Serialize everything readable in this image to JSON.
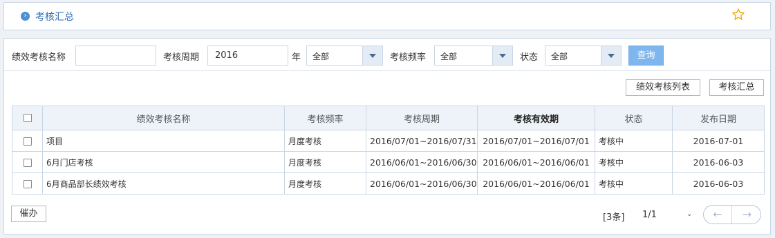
{
  "header": {
    "title": "考核汇总",
    "arrow_icon": "›"
  },
  "filter": {
    "name_label": "绩效考核名称",
    "name_value": "",
    "period_label": "考核周期",
    "period_value": "2016",
    "year_suffix": "年",
    "year_select": "全部",
    "frequency_label": "考核频率",
    "frequency_select": "全部",
    "status_label": "状态",
    "status_select": "全部",
    "query_label": "查询"
  },
  "toolbar": {
    "list_label": "绩效考核列表",
    "summary_label": "考核汇总"
  },
  "table": {
    "columns": [
      "绩效考核名称",
      "考核频率",
      "考核周期",
      "考核有效期",
      "状态",
      "发布日期"
    ],
    "rows": [
      {
        "name": "项目",
        "frequency": "月度考核",
        "period": "2016/07/01~2016/07/31",
        "validity": "2016/07/01~2016/07/01",
        "status": "考核中",
        "date": "2016-07-01"
      },
      {
        "name": "6月门店考核",
        "frequency": "月度考核",
        "period": "2016/06/01~2016/06/30",
        "validity": "2016/06/01~2016/06/01",
        "status": "考核中",
        "date": "2016-06-03"
      },
      {
        "name": "6月商品部长绩效考核",
        "frequency": "月度考核",
        "period": "2016/06/01~2016/06/30",
        "validity": "2016/06/01~2016/06/01",
        "status": "考核中",
        "date": "2016-06-03"
      }
    ]
  },
  "footer": {
    "urge_label": "催办",
    "count": "[3条]",
    "page": "1/1",
    "chevron": "⌄",
    "prev": "←",
    "next": "→"
  },
  "colors": {
    "accent": "#2f6db5",
    "query_button": "#7fb6ee",
    "star": "#f0a500"
  }
}
